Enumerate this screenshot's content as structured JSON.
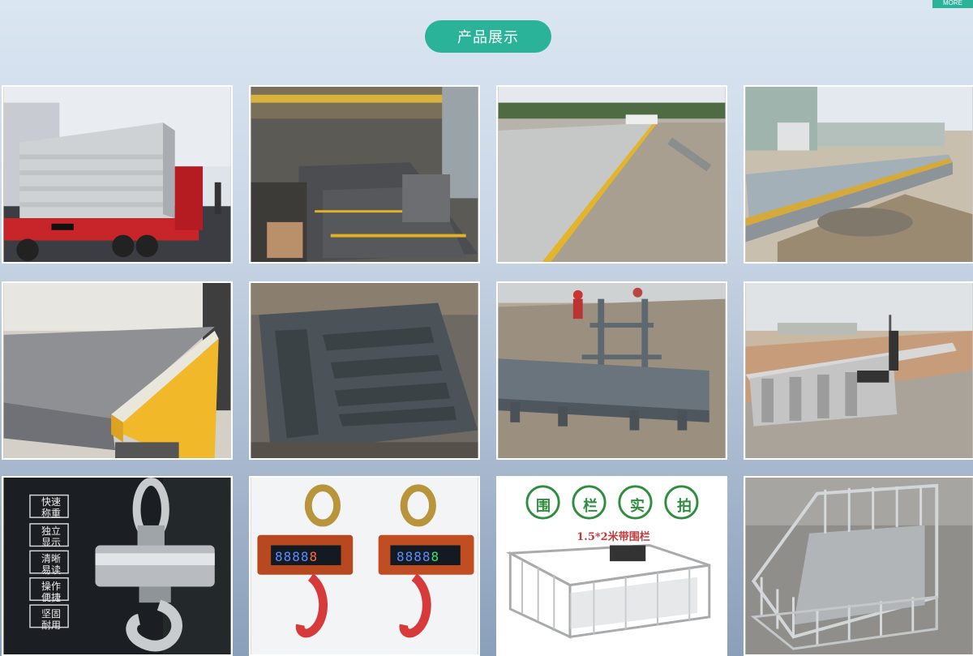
{
  "header": {
    "more_label": "MORE",
    "title": "产品展示"
  },
  "products": [
    {
      "name": "truck-scale-platforms-on-truck"
    },
    {
      "name": "truck-scale-factory-floor"
    },
    {
      "name": "truck-scale-installed-yellow-edge"
    },
    {
      "name": "truck-scale-installed-pit"
    },
    {
      "name": "platform-scale-checker-plate"
    },
    {
      "name": "platform-scale-frame"
    },
    {
      "name": "truck-scale-foundation-frame"
    },
    {
      "name": "truck-scale-construction-site"
    },
    {
      "name": "crane-scale-steel",
      "labels": [
        "快速称重",
        "独立显示",
        "清晰易读",
        "操作便捷",
        "坚固耐用"
      ],
      "labels_split": [
        [
          "快速",
          "称重"
        ],
        [
          "独立",
          "显示"
        ],
        [
          "清晰",
          "易读"
        ],
        [
          "操作",
          "便捷"
        ],
        [
          "坚固",
          "耐用"
        ]
      ]
    },
    {
      "name": "crane-scale-digital-display",
      "display": [
        "8888",
        "8"
      ]
    },
    {
      "name": "livestock-fence-scale",
      "chars": [
        "围",
        "栏",
        "实",
        "拍"
      ],
      "caption": "1.5*2米带围栏"
    },
    {
      "name": "livestock-fence-scale-photo"
    }
  ],
  "colors": {
    "accent": "#2bb39a",
    "card_border": "#ffffff"
  }
}
